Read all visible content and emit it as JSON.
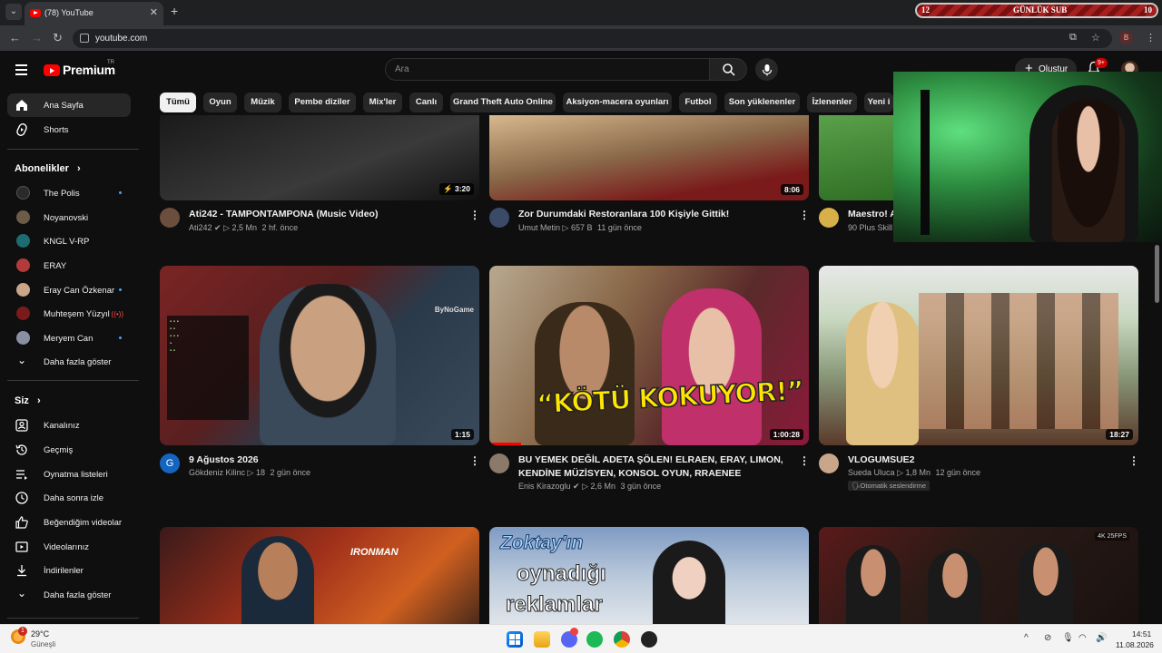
{
  "browser": {
    "tab_title": "(78) YouTube",
    "url": "youtube.com",
    "profile_initial": "B",
    "sub_banner": {
      "left": "12",
      "center": "GÜNLÜK SUB",
      "right": "10"
    }
  },
  "masthead": {
    "logo": "Premium",
    "logo_region": "TR",
    "search_placeholder": "Ara",
    "create_label": "Oluştur",
    "notif_count": "9+"
  },
  "sidebar": {
    "main": [
      {
        "label": "Ana Sayfa",
        "icon": "home-icon"
      },
      {
        "label": "Shorts",
        "icon": "shorts-icon"
      }
    ],
    "subs_header": "Abonelikler",
    "subscriptions": [
      {
        "label": "The Polis",
        "color": "#2a2a2a",
        "indicator": "dot"
      },
      {
        "label": "Noyanovski",
        "color": "#6b5c4a",
        "indicator": ""
      },
      {
        "label": "KNGL V-RP",
        "color": "#1e6b72",
        "indicator": ""
      },
      {
        "label": "ERAY",
        "color": "#b33a3a",
        "indicator": ""
      },
      {
        "label": "Eray Can Özkenar",
        "color": "#c9a58a",
        "indicator": "dot"
      },
      {
        "label": "Muhteşem Yüzyıl",
        "color": "#7a1a1a",
        "indicator": "live"
      },
      {
        "label": "Meryem Can",
        "color": "#8a8fa3",
        "indicator": "dot"
      }
    ],
    "subs_more": "Daha fazla göster",
    "you_header": "Siz",
    "you_items": [
      {
        "label": "Kanalınız",
        "icon": "channel-icon"
      },
      {
        "label": "Geçmiş",
        "icon": "history-icon"
      },
      {
        "label": "Oynatma listeleri",
        "icon": "playlist-icon"
      },
      {
        "label": "Daha sonra izle",
        "icon": "clock-icon"
      },
      {
        "label": "Beğendiğim videolar",
        "icon": "like-icon"
      },
      {
        "label": "Videolarınız",
        "icon": "video-icon"
      },
      {
        "label": "İndirilenler",
        "icon": "download-icon"
      },
      {
        "label": "Daha fazla göster",
        "icon": "chevron-down-icon"
      }
    ]
  },
  "chips": [
    "Tümü",
    "Oyun",
    "Müzik",
    "Pembe diziler",
    "Mix'ler",
    "Canlı",
    "Grand Theft Auto Online",
    "Aksiyon-macera oyunları",
    "Futbol",
    "Son yüklenenler",
    "İzlenenler",
    "Yeni i"
  ],
  "videos": [
    {
      "title": "Ati242 - TAMPONTAMPONA (Music Video)",
      "title2": "",
      "channel": "Ati242",
      "verified": true,
      "views": "2,5 Mn",
      "age": "2 hf. önce",
      "duration": "3:20",
      "shorts_icon": true,
      "thumb": [
        "#1a1a1a",
        "#3a3a3a"
      ],
      "avatar": "#6b4e3d"
    },
    {
      "title": "Zor Durumdaki Restoranlara 100 Kişiyle Gittik!",
      "title2": "",
      "channel": "Umut Metin",
      "verified": false,
      "views": "657 B",
      "age": "11 gün önce",
      "duration": "8:06",
      "shorts_icon": false,
      "thumb": [
        "#c8a57a",
        "#7a1a1a"
      ],
      "avatar": "#3b4a66"
    },
    {
      "title": "Maestro! A",
      "title2": "",
      "channel": "90 Plus Skill",
      "verified": false,
      "views": "",
      "age": "",
      "duration": "",
      "shorts_icon": false,
      "thumb": [
        "#3f8a2e",
        "#1f4a17"
      ],
      "avatar": "#d8b04a"
    },
    {
      "title": "9 Ağustos 2026",
      "title2": "",
      "channel": "Gökdeniz Kilinc",
      "verified": false,
      "views": "18",
      "age": "2 gün önce",
      "duration": "1:15",
      "shorts_icon": false,
      "thumb": [
        "#6b2a2a",
        "#2a3a4a"
      ],
      "avatar": "#1565c0",
      "avatar_letter": "G",
      "watermark": "ByNoGame"
    },
    {
      "title": "BU YEMEK DEĞİL ADETA ŞÖLEN! ELRAEN, ERAY, LIMON,",
      "title2": "KENDİNE MÜZİSYEN, KONSOL OYUN, RRAENEE",
      "channel": "Enis Kirazoglu",
      "verified": true,
      "views": "2,6 Mn",
      "age": "3 gün önce",
      "duration": "1:00:28",
      "shorts_icon": false,
      "thumb": [
        "#8a6a4a",
        "#5a1f2a"
      ],
      "avatar": "#8a7a6a",
      "overlay_text": "“KÖTÜ KOKUYOR!”",
      "progress": 0.1
    },
    {
      "title": "VLOGUMSUE2",
      "title2": "",
      "channel": "Sueda Ulucа",
      "verified": false,
      "views": "1,8 Mn",
      "age": "12 gün önce",
      "duration": "18:27",
      "shorts_icon": false,
      "thumb": [
        "#e8d8c0",
        "#5a7a4a"
      ],
      "avatar": "#c9a58a",
      "tag": "Otomatik seslendirme"
    },
    {
      "title": "",
      "title2": "",
      "channel": "",
      "verified": false,
      "views": "",
      "age": "",
      "duration": "",
      "shorts_icon": false,
      "thumb": [
        "#a0301a",
        "#2a1a1a"
      ],
      "avatar": "",
      "overlay_text": "IRONMAN"
    },
    {
      "title": "",
      "title2": "",
      "channel": "",
      "verified": false,
      "views": "",
      "age": "",
      "duration": "",
      "shorts_icon": false,
      "thumb": [
        "#8aa0c0",
        "#e0e4ea"
      ],
      "avatar": "",
      "overlay_text": "Zoktay'ın",
      "overlay_text2": "oynadığı",
      "overlay_text3": "reklamlar"
    },
    {
      "title": "",
      "title2": "",
      "channel": "",
      "verified": false,
      "views": "",
      "age": "",
      "duration": "",
      "shorts_icon": false,
      "thumb": [
        "#3a2a22",
        "#1a1210"
      ],
      "avatar": "",
      "badge": "4K 25FPS"
    }
  ],
  "taskbar": {
    "weather_temp": "29°C",
    "weather_desc": "Güneşli",
    "weather_badge": "1",
    "time": "14:51",
    "date": "11.08.2026"
  }
}
